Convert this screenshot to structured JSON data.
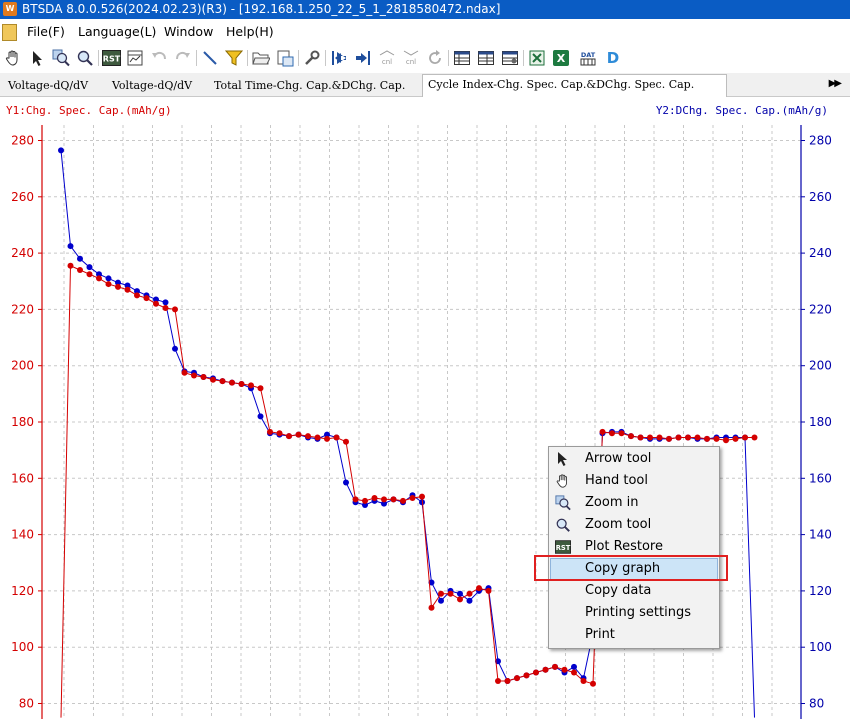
{
  "window": {
    "title": "BTSDA 8.0.0.526(2024.02.23)(R3) - [192.168.1.250_22_5_1_2818580472.ndax]",
    "app_icon_text": "W"
  },
  "menu": [
    "File(F)",
    "Language(L)",
    "Window",
    "Help(H)"
  ],
  "toolbar_icons": [
    "hand-tool-icon",
    "arrow-tool-icon",
    "zoom-in-icon",
    "zoom-tool-icon",
    "plot-restore-icon",
    "undo-icon",
    "redo-icon",
    "line-tool-icon",
    "filter-icon",
    "open-folder-icon",
    "save-as-icon",
    "wrench-icon",
    "arrow-left-icon",
    "arrow-right-icon",
    "cycle-prev-icon",
    "cycle-next-icon",
    "refresh-icon",
    "table-icon",
    "table-edit-icon",
    "table-settings-icon",
    "excel-export-icon",
    "excel-icon",
    "data-qr-icon",
    "d-icon"
  ],
  "toolbar_text": {
    "cycle_prev": "cnl",
    "cycle_next": "cnl",
    "data_qr": "DAT",
    "d_label": "D",
    "plot_restore": "RST"
  },
  "tabs": [
    {
      "label": "Voltage-dQ/dV",
      "active": false
    },
    {
      "label": "Voltage-dQ/dV",
      "active": false
    },
    {
      "label": "Total Time-Chg. Cap.&DChg. Cap.",
      "active": false
    },
    {
      "label": "Cycle Index-Chg. Spec. Cap.&DChg. Spec. Cap.",
      "active": true
    }
  ],
  "tab_scroll": "▶▶",
  "colors": {
    "title_bar": "#0a5cc4",
    "charge": "#d40000",
    "discharge": "#0000cc",
    "highlight_box": "#e02020",
    "menu_highlight": "#cce4f7"
  },
  "chart_data": {
    "type": "line",
    "y1_title": "Y1:Chg. Spec. Cap.(mAh/g)",
    "y2_title": "Y2:DChg. Spec. Cap.(mAh/g)",
    "y_ticks": [
      "280",
      "260",
      "240",
      "220",
      "200",
      "180",
      "160",
      "140",
      "120",
      "100",
      "80"
    ],
    "ylim": [
      74,
      284
    ],
    "grid": true,
    "series": [
      {
        "color": "#d40000",
        "x": [
          1,
          2,
          3,
          4,
          5,
          6,
          7,
          8,
          9,
          10,
          11,
          12,
          13,
          14,
          15,
          16,
          17,
          18,
          19,
          20,
          21,
          22,
          23,
          24,
          25,
          26,
          27,
          28,
          29,
          30,
          31,
          32,
          33,
          34,
          35,
          36,
          37,
          38,
          39,
          40,
          41,
          42,
          43,
          44,
          45,
          46,
          47,
          48,
          49,
          50,
          51,
          52,
          53,
          54,
          55,
          56,
          57,
          58,
          59,
          60,
          61,
          62,
          63,
          64,
          65,
          66,
          67,
          68,
          69,
          70,
          71,
          72,
          73,
          74
        ],
        "values": [
          75,
          235.5,
          234,
          232.5,
          231,
          229,
          228,
          227,
          225,
          224,
          222,
          220.5,
          220,
          197.5,
          196.5,
          196,
          195,
          194.5,
          194,
          193.5,
          193,
          192,
          176.5,
          176,
          175,
          175.5,
          175,
          174.5,
          174,
          174.5,
          173,
          152.5,
          152,
          153,
          152.5,
          152.5,
          152,
          153,
          153.5,
          114,
          119,
          119,
          117,
          119,
          121,
          120,
          88,
          88,
          89,
          90,
          91,
          92,
          93,
          92,
          91,
          88,
          87,
          176.5,
          176,
          176,
          175,
          174.5,
          174.5,
          174.5,
          174,
          174.5,
          174.5,
          174.5,
          174,
          174,
          173.5,
          174,
          174.5,
          174.5
        ]
      },
      {
        "color": "#0000cc",
        "x": [
          1,
          2,
          3,
          4,
          5,
          6,
          7,
          8,
          9,
          10,
          11,
          12,
          13,
          14,
          15,
          16,
          17,
          18,
          19,
          20,
          21,
          22,
          23,
          24,
          25,
          26,
          27,
          28,
          29,
          30,
          31,
          32,
          33,
          34,
          35,
          36,
          37,
          38,
          39,
          40,
          41,
          42,
          43,
          44,
          45,
          46,
          47,
          48,
          49,
          50,
          51,
          52,
          53,
          54,
          55,
          56,
          57,
          58,
          59,
          60,
          61,
          62,
          63,
          64,
          65,
          66,
          67,
          68,
          69,
          70,
          71,
          72,
          73,
          74
        ],
        "values": [
          276.5,
          242.5,
          238,
          235,
          232.5,
          231,
          229.5,
          228.5,
          226.5,
          225,
          223.5,
          222.5,
          206,
          198,
          197.5,
          196,
          195.5,
          194.5,
          194,
          193.5,
          192,
          182,
          176,
          175.5,
          175,
          175.5,
          174.5,
          174,
          175.5,
          174.5,
          158.5,
          151.5,
          150.5,
          152,
          151,
          152.5,
          151.5,
          154,
          151.5,
          123,
          116.5,
          120,
          119,
          116.5,
          120,
          121,
          95,
          88,
          89,
          90,
          91,
          92,
          93,
          91,
          93,
          89,
          105,
          176,
          176.5,
          176.5,
          175,
          174.5,
          174,
          174,
          174,
          174.5,
          174.5,
          174,
          174,
          174.5,
          174.5,
          174.5,
          174.5,
          75
        ]
      }
    ]
  },
  "context_menu": [
    {
      "label": "Arrow tool",
      "icon": "arrow-tool-icon",
      "highlighted": false
    },
    {
      "label": "Hand tool",
      "icon": "hand-tool-icon",
      "highlighted": false
    },
    {
      "label": "Zoom in",
      "icon": "zoom-in-icon",
      "highlighted": false
    },
    {
      "label": "Zoom tool",
      "icon": "zoom-tool-icon",
      "highlighted": false
    },
    {
      "label": "Plot Restore",
      "icon": "plot-restore-icon",
      "highlighted": false
    },
    {
      "label": "Copy graph",
      "icon": "",
      "highlighted": true
    },
    {
      "label": "Copy data",
      "icon": "",
      "highlighted": false
    },
    {
      "label": "Printing settings",
      "icon": "",
      "highlighted": false
    },
    {
      "label": "Print",
      "icon": "",
      "highlighted": false
    }
  ]
}
